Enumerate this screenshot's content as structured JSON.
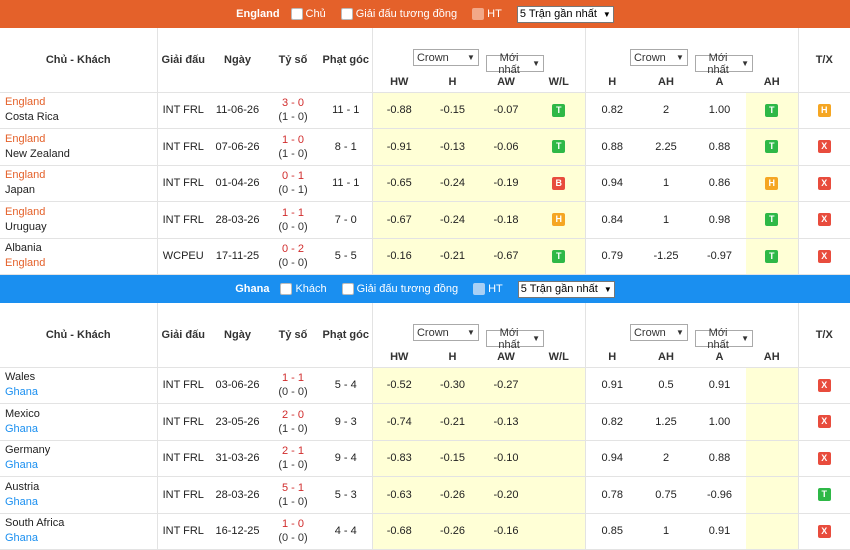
{
  "england": {
    "team": "England",
    "opt_home": "Chủ",
    "opt_same": "Giải đấu tương đồng",
    "opt_ht": "HT",
    "recent": "5 Trận gần nhất",
    "headers": {
      "teams": "Chủ - Khách",
      "league": "Giải đấu",
      "date": "Ngày",
      "score": "Tỷ số",
      "corner": "Phạt góc",
      "crown": "Crown",
      "latest": "Mới nhất",
      "hw": "HW",
      "h": "H",
      "aw": "AW",
      "wl": "W/L",
      "h2": "H",
      "ah": "AH",
      "a": "A",
      "ah2": "AH",
      "tx": "T/X"
    },
    "rows": [
      {
        "home": "England",
        "away": "Costa Rica",
        "league": "INT FRL",
        "date": "11-06-26",
        "ft": "3 - 0",
        "ht": "(1 - 0)",
        "corner": "11 - 1",
        "hw": "-0.88",
        "h": "-0.15",
        "aw": "-0.07",
        "wl": "T",
        "oh": "0.82",
        "ah": "2",
        "oa": "1.00",
        "ahr": "T",
        "tx": "H"
      },
      {
        "home": "England",
        "away": "New Zealand",
        "league": "INT FRL",
        "date": "07-06-26",
        "ft": "1 - 0",
        "ht": "(1 - 0)",
        "corner": "8 - 1",
        "hw": "-0.91",
        "h": "-0.13",
        "aw": "-0.06",
        "wl": "T",
        "oh": "0.88",
        "ah": "2.25",
        "oa": "0.88",
        "ahr": "T",
        "tx": "X"
      },
      {
        "home": "England",
        "away": "Japan",
        "league": "INT FRL",
        "date": "01-04-26",
        "ft": "0 - 1",
        "ht": "(0 - 1)",
        "corner": "11 - 1",
        "hw": "-0.65",
        "h": "-0.24",
        "aw": "-0.19",
        "wl": "B",
        "oh": "0.94",
        "ah": "1",
        "oa": "0.86",
        "ahr": "H",
        "tx": "X"
      },
      {
        "home": "England",
        "away": "Uruguay",
        "league": "INT FRL",
        "date": "28-03-26",
        "ft": "1 - 1",
        "ht": "(0 - 0)",
        "corner": "7 - 0",
        "hw": "-0.67",
        "h": "-0.24",
        "aw": "-0.18",
        "wl": "H",
        "oh": "0.84",
        "ah": "1",
        "oa": "0.98",
        "ahr": "T",
        "tx": "X"
      },
      {
        "home": "Albania",
        "away": "England",
        "league": "WCPEU",
        "date": "17-11-25",
        "ft": "0 - 2",
        "ht": "(0 - 0)",
        "corner": "5 - 5",
        "hw": "-0.16",
        "h": "-0.21",
        "aw": "-0.67",
        "wl": "T",
        "oh": "0.79",
        "ah": "-1.25",
        "oa": "-0.97",
        "ahr": "T",
        "tx": "X"
      }
    ]
  },
  "ghana": {
    "team": "Ghana",
    "opt_away": "Khách",
    "opt_same": "Giải đấu tương đồng",
    "opt_ht": "HT",
    "recent": "5 Trận gần nhất",
    "headers": {
      "teams": "Chủ - Khách",
      "league": "Giải đấu",
      "date": "Ngày",
      "score": "Tỷ số",
      "corner": "Phạt góc",
      "crown": "Crown",
      "latest": "Mới nhất",
      "hw": "HW",
      "h": "H",
      "aw": "AW",
      "wl": "W/L",
      "h2": "H",
      "ah": "AH",
      "a": "A",
      "ah2": "AH",
      "tx": "T/X"
    },
    "rows": [
      {
        "home": "Wales",
        "away": "Ghana",
        "league": "INT FRL",
        "date": "03-06-26",
        "ft": "1 - 1",
        "ht": "(0 - 0)",
        "corner": "5 - 4",
        "hw": "-0.52",
        "h": "-0.30",
        "aw": "-0.27",
        "wl": "",
        "oh": "0.91",
        "ah": "0.5",
        "oa": "0.91",
        "ahr": "",
        "tx": "X"
      },
      {
        "home": "Mexico",
        "away": "Ghana",
        "league": "INT FRL",
        "date": "23-05-26",
        "ft": "2 - 0",
        "ht": "(1 - 0)",
        "corner": "9 - 3",
        "hw": "-0.74",
        "h": "-0.21",
        "aw": "-0.13",
        "wl": "",
        "oh": "0.82",
        "ah": "1.25",
        "oa": "1.00",
        "ahr": "",
        "tx": "X"
      },
      {
        "home": "Germany",
        "away": "Ghana",
        "league": "INT FRL",
        "date": "31-03-26",
        "ft": "2 - 1",
        "ht": "(1 - 0)",
        "corner": "9 - 4",
        "hw": "-0.83",
        "h": "-0.15",
        "aw": "-0.10",
        "wl": "",
        "oh": "0.94",
        "ah": "2",
        "oa": "0.88",
        "ahr": "",
        "tx": "X"
      },
      {
        "home": "Austria",
        "away": "Ghana",
        "league": "INT FRL",
        "date": "28-03-26",
        "ft": "5 - 1",
        "ht": "(1 - 0)",
        "corner": "5 - 3",
        "hw": "-0.63",
        "h": "-0.26",
        "aw": "-0.20",
        "wl": "",
        "oh": "0.78",
        "ah": "0.75",
        "oa": "-0.96",
        "ahr": "",
        "tx": "T"
      },
      {
        "home": "South Africa",
        "away": "Ghana",
        "league": "INT FRL",
        "date": "16-12-25",
        "ft": "1 - 0",
        "ht": "(0 - 0)",
        "corner": "4 - 4",
        "hw": "-0.68",
        "h": "-0.26",
        "aw": "-0.16",
        "wl": "",
        "oh": "0.85",
        "ah": "1",
        "oa": "0.91",
        "ahr": "",
        "tx": "X"
      }
    ]
  },
  "colors": {
    "orange": "#e4612a",
    "blue": "#1a8ff0",
    "win": "#2eb847",
    "loss": "#e84c3d",
    "draw": "#f5a623",
    "highlight": "#ffffd6"
  }
}
